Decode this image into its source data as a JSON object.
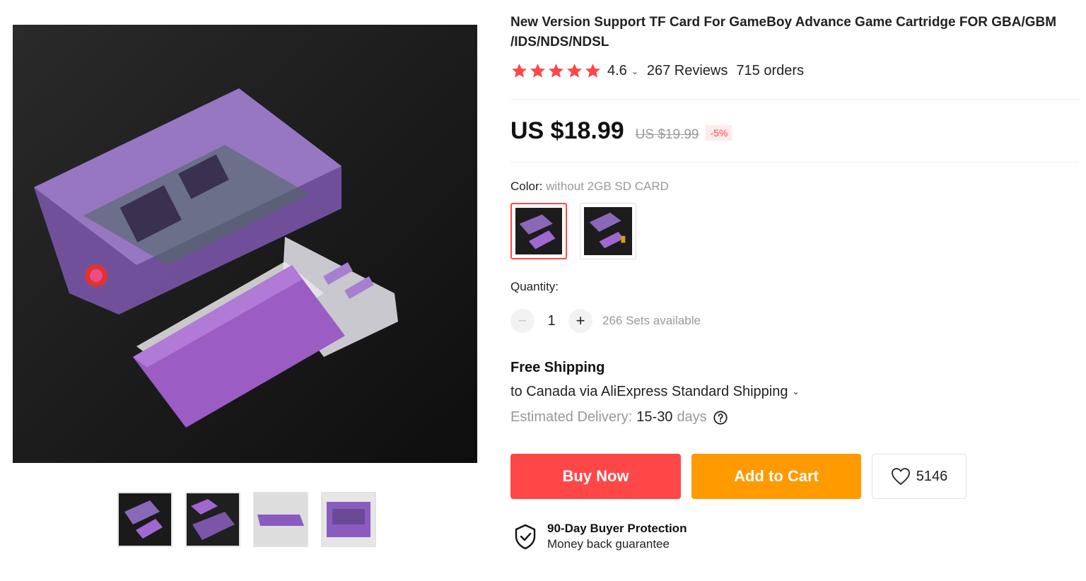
{
  "product": {
    "title": "New Version Support TF Card For GameBoy Advance Game Cartridge FOR GBA/GBM /IDS/NDS/NDSL",
    "rating": "4.6",
    "reviews": "267 Reviews",
    "orders": "715 orders"
  },
  "price": {
    "current": "US $18.99",
    "original": "US $19.99",
    "discount": "-5%"
  },
  "color": {
    "label": "Color:",
    "selected": "without 2GB SD CARD",
    "options_count": 2
  },
  "quantity": {
    "label": "Quantity:",
    "minus": "−",
    "value": "1",
    "plus": "+",
    "available": "266 Sets available"
  },
  "shipping": {
    "title": "Free Shipping",
    "line": "to Canada via AliExpress Standard Shipping",
    "eta_label": "Estimated Delivery:",
    "eta_value": "15-30",
    "eta_unit": "days"
  },
  "actions": {
    "buy_now": "Buy Now",
    "add_to_cart": "Add to Cart",
    "wishlist_count": "5146"
  },
  "protection": {
    "title": "90-Day Buyer Protection",
    "subtitle": "Money back guarantee"
  },
  "colors": {
    "accent_red": "#ff4747",
    "accent_orange": "#ff9a00",
    "star": "#ff4747",
    "product_purple": "#9b5cc4"
  },
  "icons": [
    "star-icon",
    "chevron-down-icon",
    "help-icon",
    "heart-icon",
    "shield-check-icon"
  ]
}
